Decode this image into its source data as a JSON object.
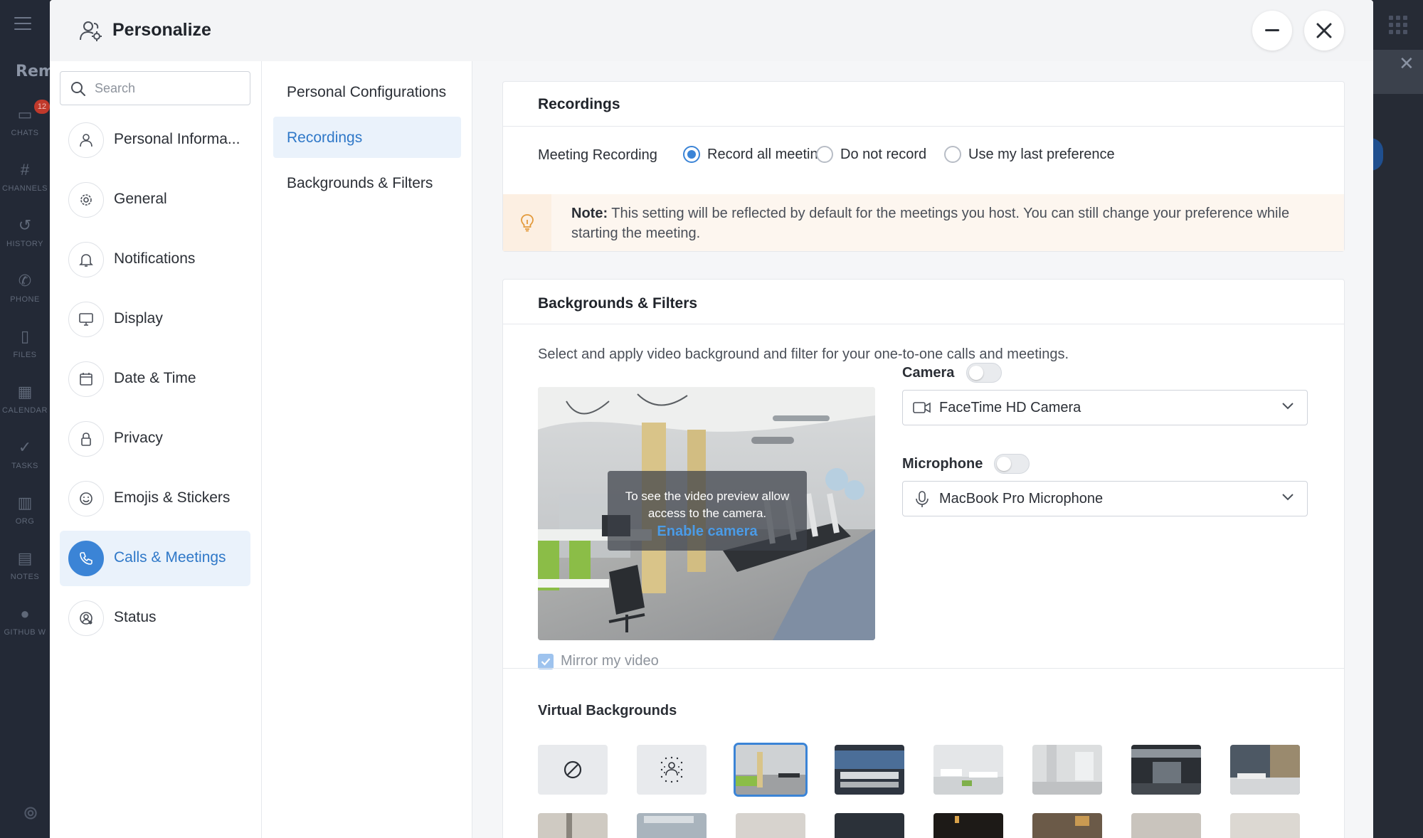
{
  "background_app": {
    "brand": "Rem",
    "rail": [
      {
        "icon": "chat-icon",
        "label": "CHATS",
        "badge": "12"
      },
      {
        "icon": "hash-icon",
        "label": "CHANNELS"
      },
      {
        "icon": "history-icon",
        "label": "HISTORY"
      },
      {
        "icon": "phone-icon",
        "label": "PHONE"
      },
      {
        "icon": "files-icon",
        "label": "FILES"
      },
      {
        "icon": "calendar-icon",
        "label": "CALENDAR"
      },
      {
        "icon": "tasks-icon",
        "label": "TASKS"
      },
      {
        "icon": "org-icon",
        "label": "ORG"
      },
      {
        "icon": "notes-icon",
        "label": "NOTES"
      },
      {
        "icon": "github-icon",
        "label": "GITHUB W"
      }
    ]
  },
  "modal": {
    "title": "Personalize"
  },
  "search": {
    "placeholder": "Search"
  },
  "left_nav": [
    {
      "icon": "person-icon",
      "label": "Personal Informa..."
    },
    {
      "icon": "gear-icon",
      "label": "General"
    },
    {
      "icon": "bell-icon",
      "label": "Notifications"
    },
    {
      "icon": "monitor-icon",
      "label": "Display"
    },
    {
      "icon": "calendar-icon",
      "label": "Date & Time"
    },
    {
      "icon": "lock-icon",
      "label": "Privacy"
    },
    {
      "icon": "smiley-icon",
      "label": "Emojis & Stickers"
    },
    {
      "icon": "phone-icon",
      "label": "Calls & Meetings",
      "active": true
    },
    {
      "icon": "status-icon",
      "label": "Status"
    }
  ],
  "sub_nav": [
    {
      "label": "Personal Configurations"
    },
    {
      "label": "Recordings",
      "active": true
    },
    {
      "label": "Backgrounds & Filters"
    }
  ],
  "recordings": {
    "title": "Recordings",
    "label": "Meeting Recording",
    "options": [
      "Record all meetings",
      "Do not record",
      "Use my last preference"
    ],
    "selected": "Record all meetings",
    "note_bold": "Note:",
    "note_text": " This setting will be reflected by default for the meetings you host. You can still change your preference while starting the meeting."
  },
  "backgrounds": {
    "title": "Backgrounds & Filters",
    "description": "Select and apply video background and filter for your one-to-one calls and meetings.",
    "preview_message": "To see the video preview allow access to the camera.",
    "enable_camera": "Enable camera",
    "mirror_label": "Mirror my video",
    "mirror_checked": true,
    "camera_label": "Camera",
    "camera_enabled": false,
    "camera_device": "FaceTime HD Camera",
    "microphone_label": "Microphone",
    "microphone_enabled": false,
    "microphone_device": "MacBook Pro Microphone",
    "virtual_title": "Virtual Backgrounds",
    "thumbnails": [
      "none-icon",
      "blur-icon",
      "office-1",
      "office-2",
      "office-3",
      "office-4",
      "office-5",
      "office-6"
    ],
    "selected_thumbnail": "office-1"
  },
  "colors": {
    "accent": "#3b84d6",
    "active_bg": "#eaf2fb",
    "note_bg": "#fdf6ef"
  }
}
